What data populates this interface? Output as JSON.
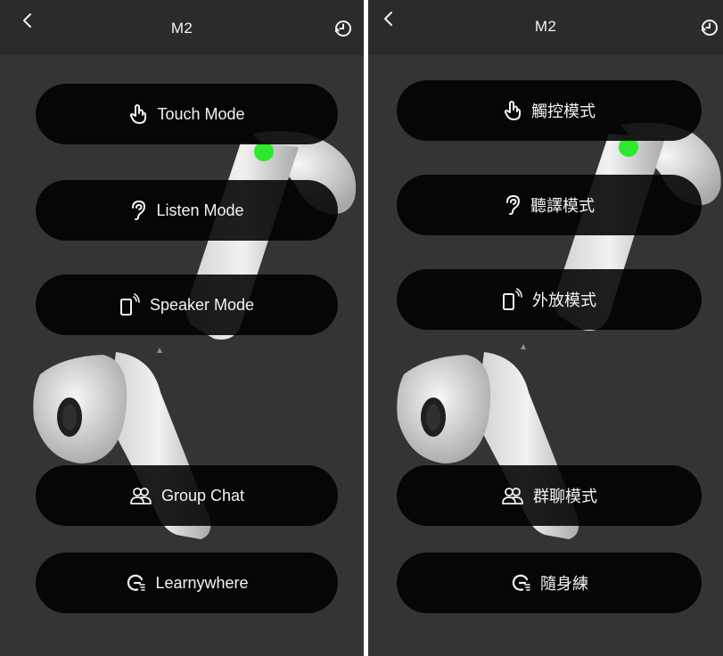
{
  "left": {
    "title": "M2",
    "buttons": [
      {
        "label": "Touch Mode",
        "icon": "touch-icon"
      },
      {
        "label": "Listen Mode",
        "icon": "ear-icon"
      },
      {
        "label": "Speaker Mode",
        "icon": "speaker-phone-icon"
      },
      {
        "label": "Group Chat",
        "icon": "group-icon"
      },
      {
        "label": "Learnywhere",
        "icon": "learnywhere-icon"
      }
    ]
  },
  "right": {
    "title": "M2",
    "buttons": [
      {
        "label": "觸控模式",
        "icon": "touch-icon"
      },
      {
        "label": "聽譯模式",
        "icon": "ear-icon"
      },
      {
        "label": "外放模式",
        "icon": "speaker-phone-icon"
      },
      {
        "label": "群聊模式",
        "icon": "group-icon"
      },
      {
        "label": "隨身練",
        "icon": "learnywhere-icon"
      }
    ]
  },
  "colors": {
    "background": "#343434",
    "topbar": "#2b2b2b",
    "button": "#000000",
    "text": "#f3f3f3",
    "indicator": "#2ee82e"
  }
}
